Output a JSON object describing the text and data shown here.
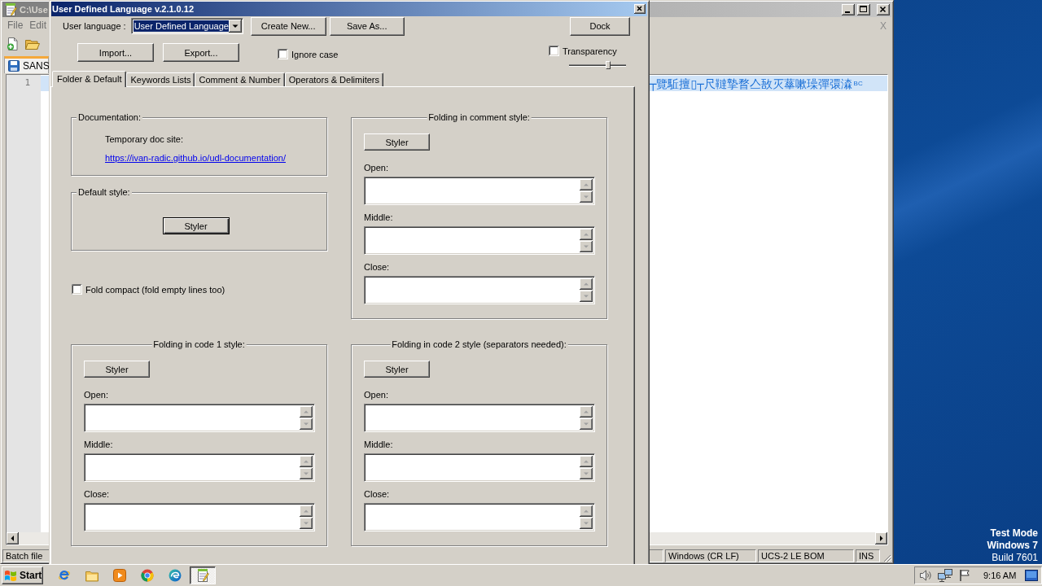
{
  "editor_window": {
    "title": "C:\\Use",
    "menu": [
      "File",
      "Edit"
    ],
    "close_mark": "X",
    "tab": {
      "label": "SANS",
      "selected": true
    },
    "line_numbers": [
      "1"
    ],
    "line_text": "┬覽駈擅▯┬尺韃摯瞀亼敔灭蕐嗽璪彈彋潹",
    "line_tail": "BC",
    "status_bar": {
      "file_type": "Batch file",
      "line_ending": "Windows (CR LF)",
      "encoding": "UCS-2 LE BOM",
      "mode": "INS"
    }
  },
  "dialog": {
    "title": "User Defined Language v.2.1.0.12",
    "language": {
      "label": "User language :",
      "value": "User Defined Language"
    },
    "top_buttons": [
      "Create New...",
      "Save As..."
    ],
    "dock_button": "Dock",
    "file_buttons": [
      "Import...",
      "Export..."
    ],
    "ignore_case": {
      "label": "Ignore case",
      "checked": false
    },
    "transparency": {
      "label": "Transparency",
      "checked": false,
      "level": 0.7
    },
    "tabs": [
      {
        "label": "Folder & Default",
        "selected": true
      },
      {
        "label": "Keywords Lists",
        "selected": false
      },
      {
        "label": "Comment & Number",
        "selected": false
      },
      {
        "label": "Operators & Delimiters",
        "selected": false
      }
    ],
    "documentation": {
      "title": "Documentation:",
      "label": "Temporary doc site:",
      "link": "https://ivan-radic.github.io/udl-documentation/"
    },
    "default_style": {
      "title": "Default style:",
      "button": "Styler",
      "focused": true
    },
    "fold_compact": {
      "label": "Fold compact (fold empty lines too)",
      "checked": false
    },
    "folding_groups": [
      {
        "title": "Folding in comment style:",
        "button": "Styler",
        "fields": [
          "Open:",
          "Middle:",
          "Close:"
        ]
      },
      {
        "title": "Folding in code 1 style:",
        "button": "Styler",
        "fields": [
          "Open:",
          "Middle:",
          "Close:"
        ]
      },
      {
        "title": "Folding in code 2 style (separators needed):",
        "button": "Styler",
        "fields": [
          "Open:",
          "Middle:",
          "Close:"
        ]
      }
    ]
  },
  "desktop": {
    "mode": "Test Mode",
    "os": "Windows 7",
    "build": "Build 7601"
  },
  "taskbar": {
    "start": "Start",
    "apps": [
      {
        "kind": "e-globe",
        "selected": false
      },
      {
        "kind": "folder",
        "selected": false
      },
      {
        "kind": "media",
        "selected": false
      },
      {
        "kind": "ring",
        "selected": false
      },
      {
        "kind": "swirl",
        "selected": false
      },
      {
        "kind": "notepad",
        "selected": true
      }
    ],
    "clock": "9:16 AM"
  }
}
